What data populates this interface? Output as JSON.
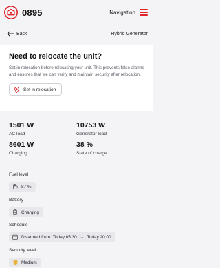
{
  "header": {
    "unit_id": "0895",
    "nav_label": "Navigation",
    "brand_color": "#e0222b"
  },
  "backrow": {
    "back_label": "Back",
    "page_subtitle": "Hybrid Generator"
  },
  "relocation_card": {
    "title": "Need to relocate the unit?",
    "body": "Set in relocation before relocating your unit. This prevents false alarms and ensures that we can verify and maintain security after relocation.",
    "button_label": "Set in relocation",
    "button_icon": "map-pin-icon"
  },
  "stats": [
    {
      "value": "1501 W",
      "label": "AC load"
    },
    {
      "value": "10753 W",
      "label": "Generator load"
    },
    {
      "value": "8601 W",
      "label": "Charging"
    },
    {
      "value": "38 %",
      "label": "State of charge"
    }
  ],
  "fuel": {
    "title": "Fuel level",
    "value": "87 %",
    "icon": "fuel-icon"
  },
  "battery": {
    "title": "Battery",
    "value": "Charging",
    "icon": "battery-icon"
  },
  "schedule": {
    "title": "Schedule",
    "status": "Disarmed from",
    "from": "Today 05:30",
    "to": "Today 20:00",
    "icon": "calendar-icon"
  },
  "security": {
    "title": "Security level",
    "value": "Medium",
    "icon": "shield-icon",
    "accent": "#e8b33a"
  }
}
